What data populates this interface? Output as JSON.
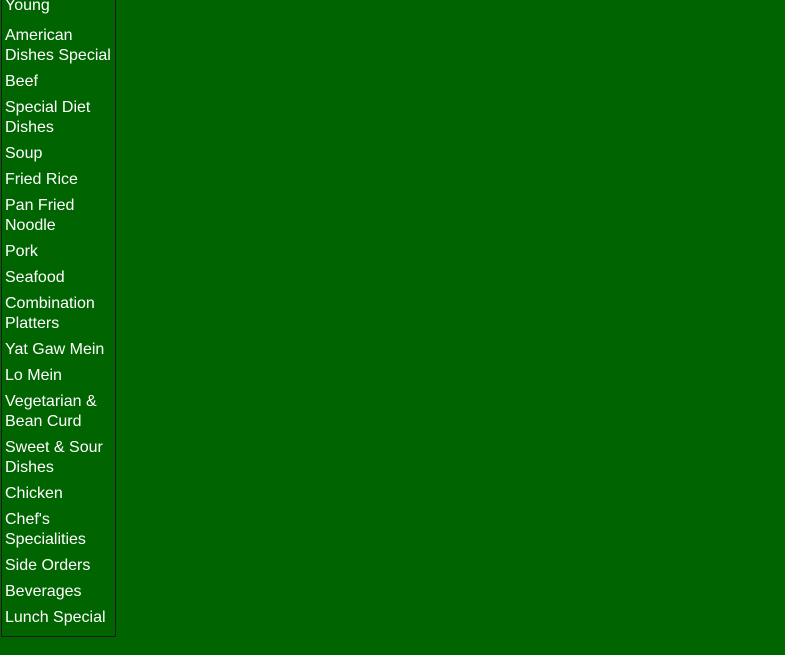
{
  "sidebar": {
    "items": [
      {
        "label": "Young"
      },
      {
        "label": "American Dishes Special"
      },
      {
        "label": "Beef"
      },
      {
        "label": "Special Diet Dishes"
      },
      {
        "label": "Soup"
      },
      {
        "label": "Fried Rice"
      },
      {
        "label": "Pan Fried Noodle"
      },
      {
        "label": "Pork"
      },
      {
        "label": "Seafood"
      },
      {
        "label": "Combination Platters"
      },
      {
        "label": "Yat Gaw Mein"
      },
      {
        "label": "Lo Mein"
      },
      {
        "label": "Vegetarian & Bean Curd"
      },
      {
        "label": "Sweet & Sour Dishes"
      },
      {
        "label": "Chicken"
      },
      {
        "label": "Chef's Specialities"
      },
      {
        "label": "Side Orders"
      },
      {
        "label": "Beverages"
      },
      {
        "label": "Lunch Special"
      }
    ]
  },
  "colors": {
    "background": "#006400",
    "link_text": "#ffffff",
    "border": "#1a1a1a"
  }
}
